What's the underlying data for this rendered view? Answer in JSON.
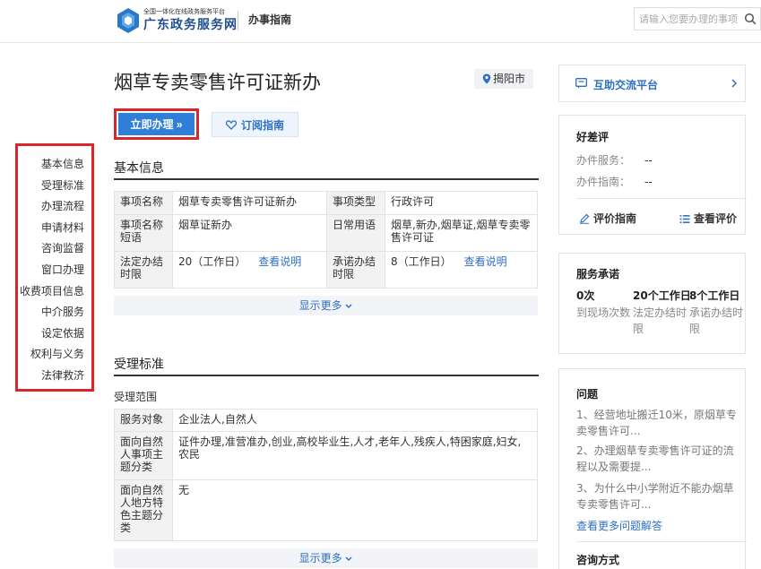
{
  "header": {
    "logo_small": "全国一体化在线政务服务平台",
    "logo_big": "广东政务服务网",
    "nav": "办事指南",
    "search_placeholder": "请输入您要办理的事项"
  },
  "left_nav": {
    "items": [
      "基本信息",
      "受理标准",
      "办理流程",
      "申请材料",
      "咨询监督",
      "窗口办理",
      "收费项目信息",
      "中介服务",
      "设定依据",
      "权利与义务",
      "法律救济"
    ]
  },
  "main": {
    "title": "烟草专卖零售许可证新办",
    "location": "揭阳市",
    "apply_label": "立即办理 »",
    "subscribe_label": "订阅指南",
    "basic": {
      "title": "基本信息",
      "rows": [
        {
          "k1": "事项名称",
          "v1": "烟草专卖零售许可证新办",
          "k2": "事项类型",
          "v2": "行政许可"
        },
        {
          "k1": "事项名称短语",
          "v1": "烟草证新办",
          "k2": "日常用语",
          "v2": "烟草,新办,烟草证,烟草专卖零售许可证"
        },
        {
          "k1": "法定办结时限",
          "v1": "20（工作日）",
          "link1": "查看说明",
          "k2": "承诺办结时限",
          "v2": "8（工作日）",
          "link2": "查看说明"
        }
      ],
      "more": "显示更多"
    },
    "acceptance": {
      "title": "受理标准",
      "scope_label": "受理范围",
      "rows": [
        {
          "k": "服务对象",
          "v": "企业法人,自然人"
        },
        {
          "k": "面向自然人事项主题分类",
          "v": "证件办理,准营准办,创业,高校毕业生,人才,老年人,残疾人,特困家庭,妇女,农民"
        },
        {
          "k": "面向自然人地方特色主题分类",
          "v": "无"
        }
      ],
      "more": "显示更多"
    }
  },
  "right": {
    "exchange": "互助交流平台",
    "rating": {
      "title": "好差评",
      "service_label": "办件服务：",
      "service_value": "--",
      "guide_label": "办件指南：",
      "guide_value": "--",
      "rate_action": "评价指南",
      "view_action": "查看评价"
    },
    "promise": {
      "title": "服务承诺",
      "items": [
        {
          "num": "0次",
          "cap": "到现场次数"
        },
        {
          "num": "20个工作日",
          "cap": "法定办结时限"
        },
        {
          "num": "8个工作日",
          "cap": "承诺办结时限"
        }
      ]
    },
    "questions": {
      "title": "问题",
      "items": [
        "1、经营地址搬迁10米，原烟草专卖零售许可...",
        "2、办理烟草专卖零售许可证的流程以及需要提...",
        "3、为什么中小学附近不能办烟草专卖零售许可..."
      ],
      "more": "查看更多问题解答",
      "consult": "咨询方式"
    }
  }
}
